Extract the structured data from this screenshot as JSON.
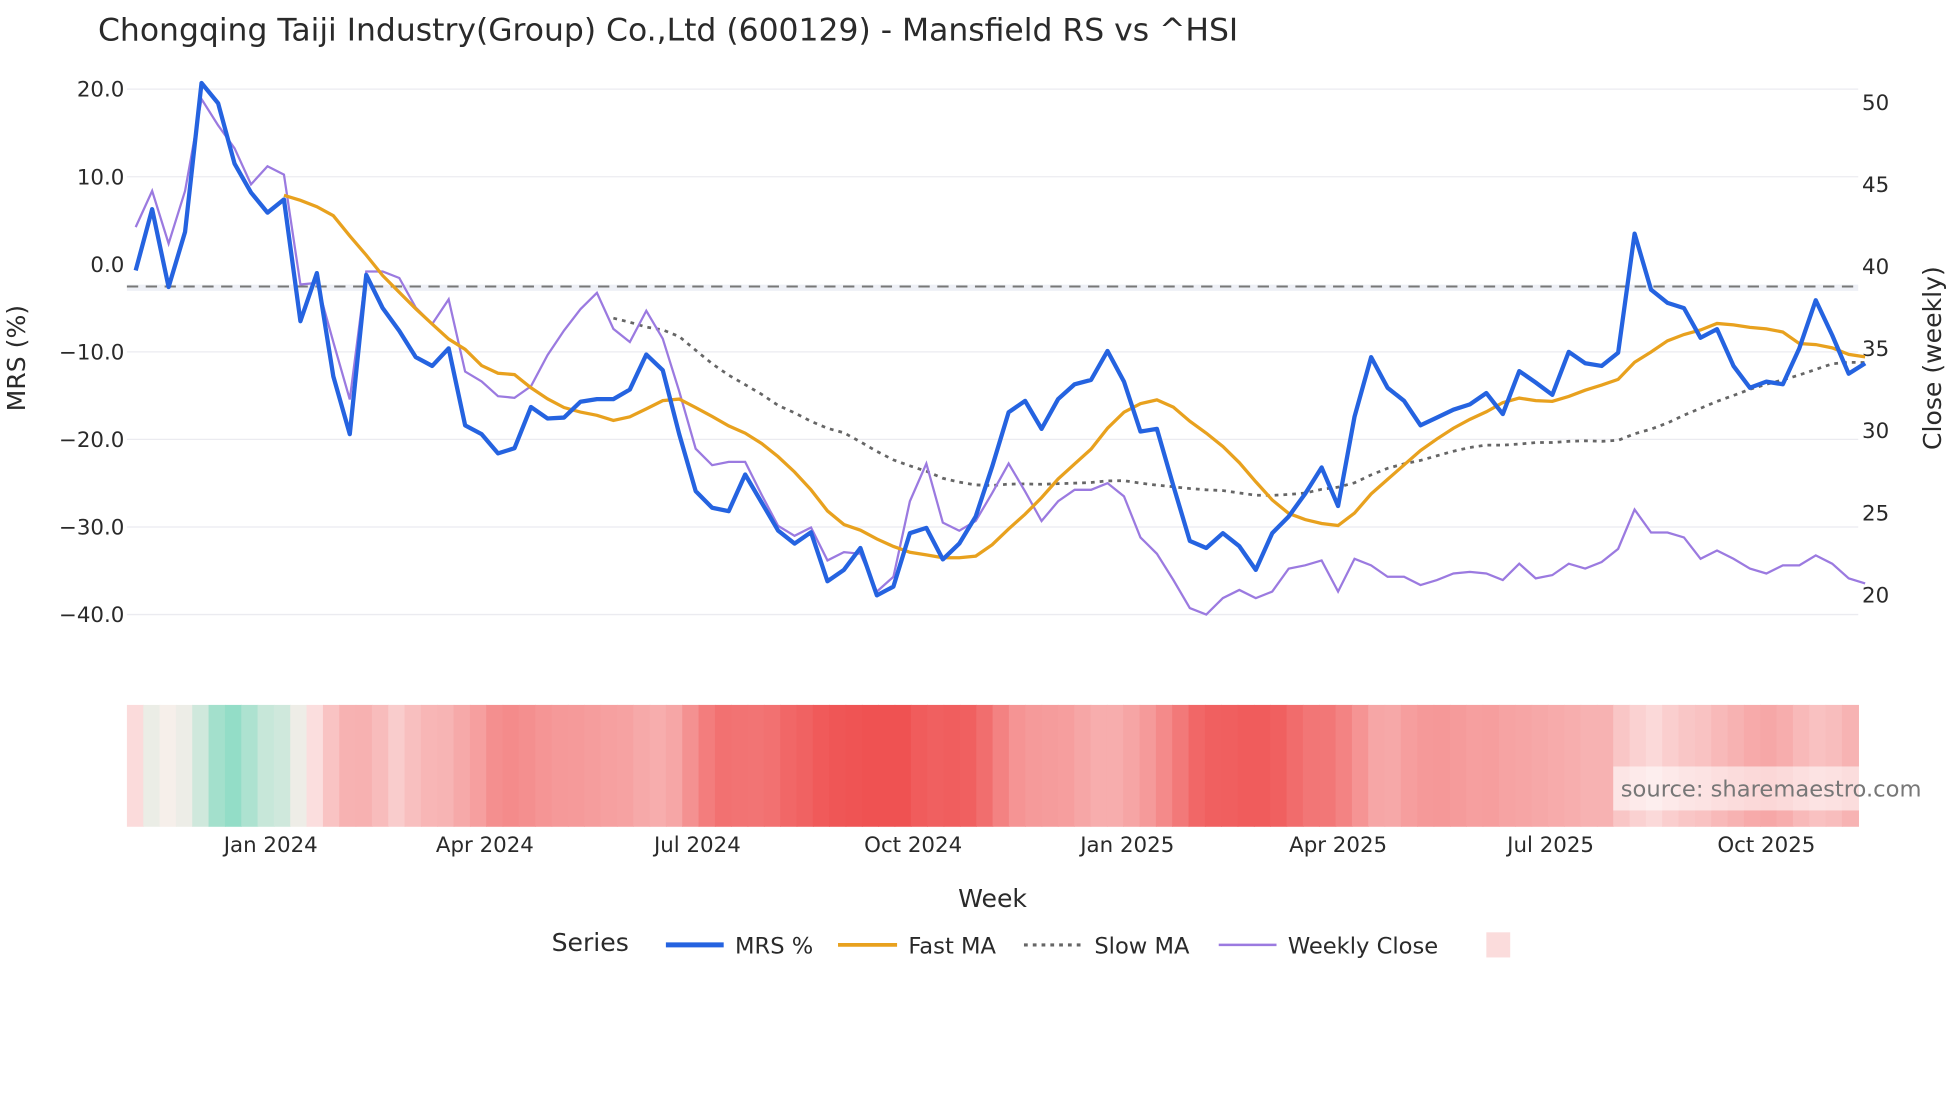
{
  "chart_data": {
    "type": "line",
    "title": "Chongqing Taiji Industry(Group) Co.,Ltd (600129) - Mansfield RS vs ^HSI",
    "xlabel": "Week",
    "ylabel": "MRS (%)",
    "y2label": "Close (weekly)",
    "ylim": [
      -43,
      23
    ],
    "y2lim": [
      17.2,
      52.4
    ],
    "y_ticks": [
      "20.0",
      "10.0",
      "0.0",
      "−10.0",
      "−20.0",
      "−30.0",
      "−40.0"
    ],
    "y_tick_values": [
      20,
      10,
      0,
      -10,
      -20,
      -30,
      -40
    ],
    "y2_ticks": [
      "50",
      "45",
      "40",
      "35",
      "30",
      "25",
      "20"
    ],
    "y2_tick_values": [
      50,
      45,
      40,
      35,
      30,
      25,
      20
    ],
    "x_ticks": [
      "Jan 2024",
      "Apr 2024",
      "Jul 2024",
      "Oct 2024",
      "Jan 2025",
      "Apr 2025",
      "Jul 2025",
      "Oct 2025"
    ],
    "x_tick_week_index": [
      8.2,
      21.2,
      34.1,
      47.2,
      60.2,
      73,
      85.9,
      99
    ],
    "zero_line": 0,
    "grid": true,
    "legend_title": "Series",
    "legend_placement": "bottom-center",
    "fast_ma_window": 10,
    "slow_ma_window": 30,
    "series": [
      {
        "name": "MRS %",
        "color": "#2563e0",
        "values": [
          -0.7,
          6.3,
          -2.6,
          3.7,
          20.7,
          18.4,
          11.5,
          8.2,
          5.9,
          7.4,
          -6.5,
          -1,
          -12.8,
          -19.4,
          -1.2,
          -5,
          -7.6,
          -10.6,
          -11.6,
          -9.6,
          -18.4,
          -19.4,
          -21.6,
          -21,
          -16.3,
          -17.6,
          -17.5,
          -15.7,
          -15.4,
          -15.4,
          -14.3,
          -10.3,
          -12.1,
          -19.4,
          -25.9,
          -27.8,
          -28.2,
          -24,
          -27.2,
          -30.4,
          -31.9,
          -30.6,
          -36.2,
          -34.9,
          -32.4,
          -37.8,
          -36.8,
          -30.7,
          -30.1,
          -33.7,
          -31.9,
          -28.8,
          -23.1,
          -16.9,
          -15.6,
          -18.8,
          -15.4,
          -13.7,
          -13.2,
          -9.9,
          -13.4,
          -19.1,
          -18.8,
          -25.3,
          -31.6,
          -32.4,
          -30.7,
          -32.2,
          -34.9,
          -30.7,
          -28.8,
          -26.2,
          -23.2,
          -27.6,
          -17.4,
          -10.6,
          -14.1,
          -15.6,
          -18.4,
          -17.5,
          -16.6,
          -16,
          -14.7,
          -17.1,
          -12.2,
          -13.5,
          -14.9,
          -10,
          -11.3,
          -11.6,
          -10.1,
          3.5,
          -2.9,
          -4.4,
          -5,
          -8.4,
          -7.4,
          -11.6,
          -14.1,
          -13.4,
          -13.7,
          -9.6,
          -4.1,
          -8.1,
          -12.5,
          -11.3
        ]
      },
      {
        "name": "Fast MA",
        "color": "#e8a11e"
      },
      {
        "name": "Slow MA",
        "color": "#666666"
      },
      {
        "name": "Weekly Close",
        "color": "#9b7ae0",
        "axis": "right",
        "values": [
          42.4,
          44.6,
          41.4,
          44.6,
          50.2,
          48.6,
          47.2,
          45,
          46.1,
          45.6,
          38.9,
          39,
          35.4,
          31.9,
          39.7,
          39.7,
          39.3,
          37.5,
          36.5,
          38,
          33.6,
          33,
          32.1,
          32,
          32.7,
          34.6,
          36.1,
          37.4,
          38.4,
          36.2,
          35.4,
          37.3,
          35.6,
          32.4,
          28.9,
          27.9,
          28.1,
          28.1,
          26.1,
          24.2,
          23.6,
          24.1,
          22.1,
          22.6,
          22.5,
          20.2,
          21.1,
          25.7,
          28,
          24.4,
          23.9,
          24.5,
          26.2,
          28,
          26.3,
          24.5,
          25.7,
          26.4,
          26.4,
          26.8,
          26,
          23.5,
          22.5,
          20.9,
          19.2,
          18.8,
          19.8,
          20.3,
          19.8,
          20.2,
          21.6,
          21.8,
          22.1,
          20.2,
          22.2,
          21.8,
          21.1,
          21.1,
          20.6,
          20.9,
          21.3,
          21.4,
          21.3,
          20.9,
          21.9,
          21,
          21.2,
          21.9,
          21.6,
          22,
          22.8,
          25.2,
          23.8,
          23.8,
          23.5,
          22.2,
          22.7,
          22.2,
          21.6,
          21.3,
          21.8,
          21.8,
          22.4,
          21.9,
          21,
          20.7
        ]
      }
    ],
    "heatmap_legend_color": "#fbdcdc",
    "source": "source: sharemaestro.com"
  }
}
